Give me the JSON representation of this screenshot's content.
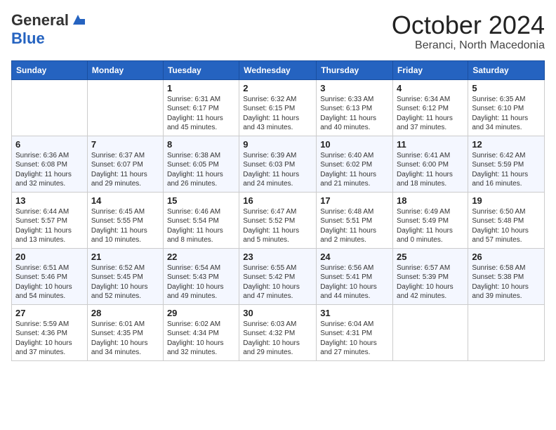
{
  "header": {
    "logo_general": "General",
    "logo_blue": "Blue",
    "month_title": "October 2024",
    "location": "Beranci, North Macedonia"
  },
  "days_of_week": [
    "Sunday",
    "Monday",
    "Tuesday",
    "Wednesday",
    "Thursday",
    "Friday",
    "Saturday"
  ],
  "weeks": [
    [
      {
        "day": "",
        "info": ""
      },
      {
        "day": "",
        "info": ""
      },
      {
        "day": "1",
        "info": "Sunrise: 6:31 AM\nSunset: 6:17 PM\nDaylight: 11 hours and 45 minutes."
      },
      {
        "day": "2",
        "info": "Sunrise: 6:32 AM\nSunset: 6:15 PM\nDaylight: 11 hours and 43 minutes."
      },
      {
        "day": "3",
        "info": "Sunrise: 6:33 AM\nSunset: 6:13 PM\nDaylight: 11 hours and 40 minutes."
      },
      {
        "day": "4",
        "info": "Sunrise: 6:34 AM\nSunset: 6:12 PM\nDaylight: 11 hours and 37 minutes."
      },
      {
        "day": "5",
        "info": "Sunrise: 6:35 AM\nSunset: 6:10 PM\nDaylight: 11 hours and 34 minutes."
      }
    ],
    [
      {
        "day": "6",
        "info": "Sunrise: 6:36 AM\nSunset: 6:08 PM\nDaylight: 11 hours and 32 minutes."
      },
      {
        "day": "7",
        "info": "Sunrise: 6:37 AM\nSunset: 6:07 PM\nDaylight: 11 hours and 29 minutes."
      },
      {
        "day": "8",
        "info": "Sunrise: 6:38 AM\nSunset: 6:05 PM\nDaylight: 11 hours and 26 minutes."
      },
      {
        "day": "9",
        "info": "Sunrise: 6:39 AM\nSunset: 6:03 PM\nDaylight: 11 hours and 24 minutes."
      },
      {
        "day": "10",
        "info": "Sunrise: 6:40 AM\nSunset: 6:02 PM\nDaylight: 11 hours and 21 minutes."
      },
      {
        "day": "11",
        "info": "Sunrise: 6:41 AM\nSunset: 6:00 PM\nDaylight: 11 hours and 18 minutes."
      },
      {
        "day": "12",
        "info": "Sunrise: 6:42 AM\nSunset: 5:59 PM\nDaylight: 11 hours and 16 minutes."
      }
    ],
    [
      {
        "day": "13",
        "info": "Sunrise: 6:44 AM\nSunset: 5:57 PM\nDaylight: 11 hours and 13 minutes."
      },
      {
        "day": "14",
        "info": "Sunrise: 6:45 AM\nSunset: 5:55 PM\nDaylight: 11 hours and 10 minutes."
      },
      {
        "day": "15",
        "info": "Sunrise: 6:46 AM\nSunset: 5:54 PM\nDaylight: 11 hours and 8 minutes."
      },
      {
        "day": "16",
        "info": "Sunrise: 6:47 AM\nSunset: 5:52 PM\nDaylight: 11 hours and 5 minutes."
      },
      {
        "day": "17",
        "info": "Sunrise: 6:48 AM\nSunset: 5:51 PM\nDaylight: 11 hours and 2 minutes."
      },
      {
        "day": "18",
        "info": "Sunrise: 6:49 AM\nSunset: 5:49 PM\nDaylight: 11 hours and 0 minutes."
      },
      {
        "day": "19",
        "info": "Sunrise: 6:50 AM\nSunset: 5:48 PM\nDaylight: 10 hours and 57 minutes."
      }
    ],
    [
      {
        "day": "20",
        "info": "Sunrise: 6:51 AM\nSunset: 5:46 PM\nDaylight: 10 hours and 54 minutes."
      },
      {
        "day": "21",
        "info": "Sunrise: 6:52 AM\nSunset: 5:45 PM\nDaylight: 10 hours and 52 minutes."
      },
      {
        "day": "22",
        "info": "Sunrise: 6:54 AM\nSunset: 5:43 PM\nDaylight: 10 hours and 49 minutes."
      },
      {
        "day": "23",
        "info": "Sunrise: 6:55 AM\nSunset: 5:42 PM\nDaylight: 10 hours and 47 minutes."
      },
      {
        "day": "24",
        "info": "Sunrise: 6:56 AM\nSunset: 5:41 PM\nDaylight: 10 hours and 44 minutes."
      },
      {
        "day": "25",
        "info": "Sunrise: 6:57 AM\nSunset: 5:39 PM\nDaylight: 10 hours and 42 minutes."
      },
      {
        "day": "26",
        "info": "Sunrise: 6:58 AM\nSunset: 5:38 PM\nDaylight: 10 hours and 39 minutes."
      }
    ],
    [
      {
        "day": "27",
        "info": "Sunrise: 5:59 AM\nSunset: 4:36 PM\nDaylight: 10 hours and 37 minutes."
      },
      {
        "day": "28",
        "info": "Sunrise: 6:01 AM\nSunset: 4:35 PM\nDaylight: 10 hours and 34 minutes."
      },
      {
        "day": "29",
        "info": "Sunrise: 6:02 AM\nSunset: 4:34 PM\nDaylight: 10 hours and 32 minutes."
      },
      {
        "day": "30",
        "info": "Sunrise: 6:03 AM\nSunset: 4:32 PM\nDaylight: 10 hours and 29 minutes."
      },
      {
        "day": "31",
        "info": "Sunrise: 6:04 AM\nSunset: 4:31 PM\nDaylight: 10 hours and 27 minutes."
      },
      {
        "day": "",
        "info": ""
      },
      {
        "day": "",
        "info": ""
      }
    ]
  ]
}
